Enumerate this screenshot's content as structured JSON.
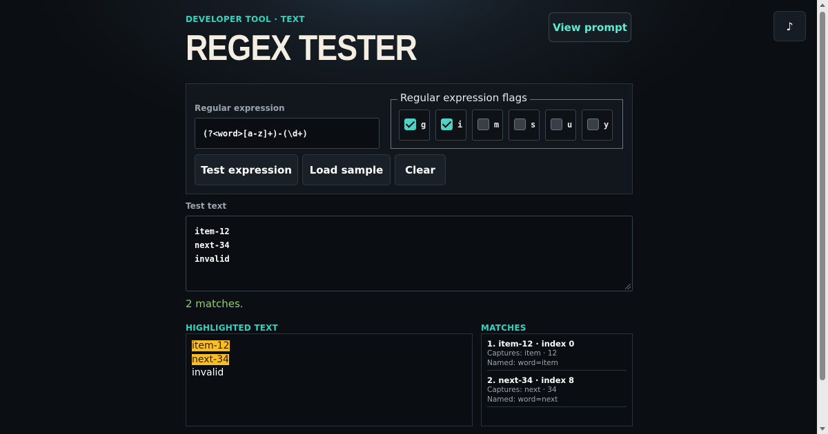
{
  "header": {
    "eyebrow": "DEVELOPER TOOL · TEXT",
    "title": "REGEX TESTER",
    "view_prompt_label": "View prompt",
    "music_icon_glyph": "♪"
  },
  "form": {
    "regex_label": "Regular expression",
    "regex_value": "(?<word>[a-z]+)-(\\d+)",
    "flags_legend": "Regular expression flags",
    "flags": [
      {
        "letter": "g",
        "checked": true
      },
      {
        "letter": "i",
        "checked": true
      },
      {
        "letter": "m",
        "checked": false
      },
      {
        "letter": "s",
        "checked": false
      },
      {
        "letter": "u",
        "checked": false
      },
      {
        "letter": "y",
        "checked": false
      }
    ],
    "buttons": {
      "test": "Test expression",
      "sample": "Load sample",
      "clear": "Clear"
    }
  },
  "test_text": {
    "label": "Test text",
    "lines": [
      "item-12",
      "next-34",
      "invalid"
    ]
  },
  "status": "2 matches.",
  "highlighted": {
    "heading": "HIGHLIGHTED TEXT",
    "lines": [
      {
        "text": "item-12",
        "matched": true
      },
      {
        "text": "next-34",
        "matched": true
      },
      {
        "text": "invalid",
        "matched": false
      }
    ]
  },
  "matches": {
    "heading": "MATCHES",
    "items": [
      {
        "title": "1. item-12 · index 0",
        "captures": "Captures: item · 12",
        "named": "Named: word=item"
      },
      {
        "title": "2. next-34 · index 8",
        "captures": "Captures: next · 34",
        "named": "Named: word=next"
      }
    ]
  },
  "colors": {
    "accent": "#2dd4bf",
    "highlight": "#fbbf24",
    "success": "#8fd16a"
  }
}
